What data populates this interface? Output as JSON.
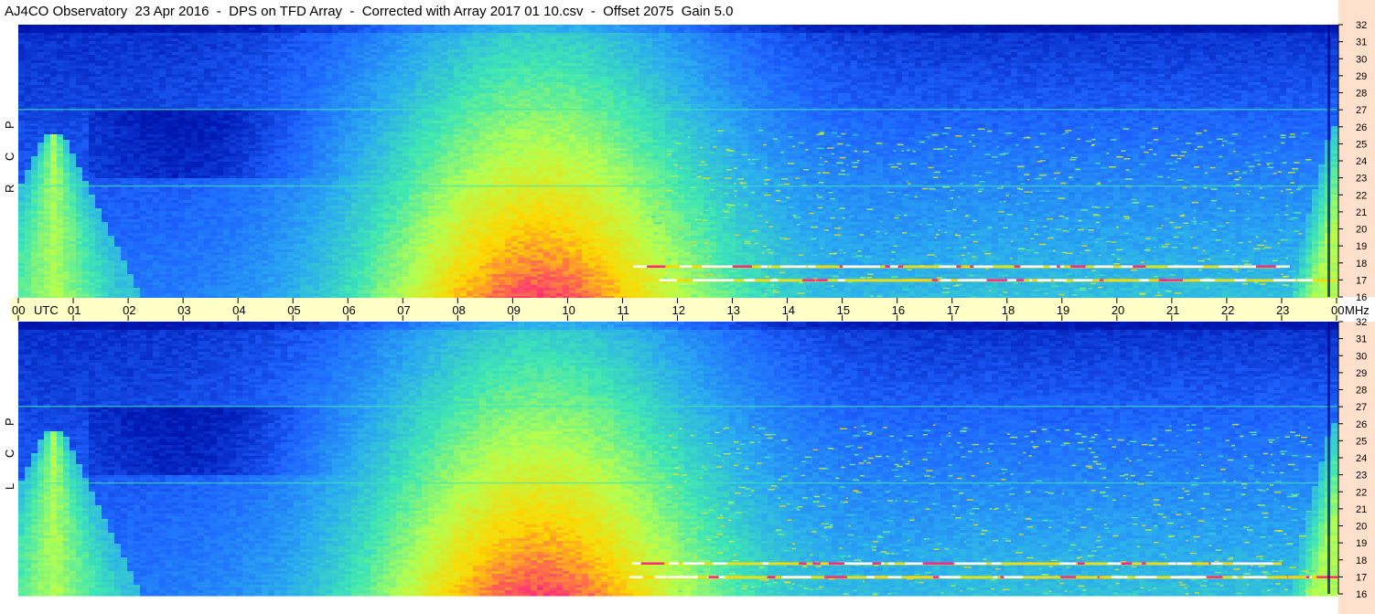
{
  "title": "AJ4CO Observatory  23 Apr 2016  -  DPS on TFD Array  -  Corrected with Array 2017 01 10.csv  -  Offset 2075  Gain 5.0",
  "colors": {
    "time_band": "#ffffc8",
    "freq_axis_bg": "#ffe0cc",
    "colormap": [
      "#00007a",
      "#0019b4",
      "#1e64ff",
      "#2aaaf0",
      "#3fe6b4",
      "#b4ff50",
      "#ffd700",
      "#ff2a7a",
      "#ffffff"
    ]
  },
  "chart_data": [
    {
      "type": "heatmap",
      "title": "",
      "panel_label": "R C P",
      "xlabel": "UTC",
      "ylabel": "MHz",
      "xlim": [
        0,
        24
      ],
      "ylim": [
        16,
        32
      ],
      "x_ticks": [
        "00",
        "01",
        "02",
        "03",
        "04",
        "05",
        "06",
        "07",
        "08",
        "09",
        "10",
        "11",
        "12",
        "13",
        "14",
        "15",
        "16",
        "17",
        "18",
        "19",
        "20",
        "21",
        "22",
        "23",
        "00"
      ],
      "y_ticks": [
        16,
        17,
        18,
        19,
        20,
        21,
        22,
        23,
        24,
        25,
        26,
        27,
        28,
        29,
        30,
        31,
        32
      ],
      "features": [
        {
          "name": "daytime background hump",
          "x_center": 9.5,
          "x_width": 3.5,
          "peak_level": 0.55
        },
        {
          "name": "sunrise emission",
          "x": [
            0.0,
            1.3
          ],
          "y": [
            16,
            25.5
          ]
        },
        {
          "name": "sunset emission",
          "x": [
            23.2,
            24.0
          ],
          "y": [
            16,
            26
          ]
        },
        {
          "name": "interference band",
          "y": 17.0,
          "x": [
            11.0,
            24.0
          ]
        },
        {
          "name": "interference band",
          "y": 17.8,
          "x": [
            11.0,
            23.0
          ]
        },
        {
          "name": "interference band",
          "y": 22.5,
          "x": [
            0.0,
            24.0
          ]
        },
        {
          "name": "interference band",
          "y": 27.0,
          "x": [
            0.0,
            24.0
          ]
        }
      ]
    },
    {
      "type": "heatmap",
      "title": "",
      "panel_label": "L C P",
      "xlabel": "UTC",
      "ylabel": "MHz",
      "xlim": [
        0,
        24
      ],
      "ylim": [
        16,
        32
      ],
      "x_ticks": [
        "00",
        "01",
        "02",
        "03",
        "04",
        "05",
        "06",
        "07",
        "08",
        "09",
        "10",
        "11",
        "12",
        "13",
        "14",
        "15",
        "16",
        "17",
        "18",
        "19",
        "20",
        "21",
        "22",
        "23",
        "00"
      ],
      "y_ticks": [
        16,
        17,
        18,
        19,
        20,
        21,
        22,
        23,
        24,
        25,
        26,
        27,
        28,
        29,
        30,
        31,
        32
      ],
      "features": [
        {
          "name": "daytime background hump",
          "x_center": 9.5,
          "x_width": 3.5,
          "peak_level": 0.55
        },
        {
          "name": "sunrise emission",
          "x": [
            0.0,
            1.3
          ],
          "y": [
            16,
            25.5
          ]
        },
        {
          "name": "sunset emission",
          "x": [
            23.2,
            24.0
          ],
          "y": [
            16,
            26
          ]
        },
        {
          "name": "interference band",
          "y": 17.0,
          "x": [
            11.0,
            24.0
          ]
        },
        {
          "name": "interference band",
          "y": 17.8,
          "x": [
            11.0,
            23.0
          ]
        },
        {
          "name": "interference band",
          "y": 22.5,
          "x": [
            0.0,
            24.0
          ]
        },
        {
          "name": "interference band",
          "y": 27.0,
          "x": [
            0.0,
            24.0
          ]
        }
      ]
    }
  ],
  "time_axis": {
    "utc_label": "UTC",
    "mhz_label": "MHz",
    "ticks": [
      "00",
      "01",
      "02",
      "03",
      "04",
      "05",
      "06",
      "07",
      "08",
      "09",
      "10",
      "11",
      "12",
      "13",
      "14",
      "15",
      "16",
      "17",
      "18",
      "19",
      "20",
      "21",
      "22",
      "23",
      "00"
    ]
  }
}
